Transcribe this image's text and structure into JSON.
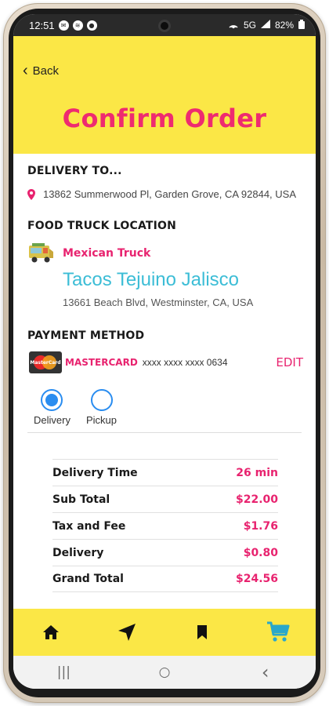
{
  "status": {
    "time": "12:51",
    "network": "5G",
    "battery": "82%"
  },
  "header": {
    "back_label": "Back",
    "title": "Confirm Order",
    "background": "#fbe746",
    "title_color": "#ee2b70"
  },
  "delivery": {
    "heading": "DELIVERY TO...",
    "address": "13862 Summerwood Pl, Garden Grove, CA 92844, USA"
  },
  "truck": {
    "heading": "FOOD TRUCK LOCATION",
    "type": "Mexican Truck",
    "name": "Tacos Tejuino Jalisco",
    "address": "13661 Beach Blvd, Westminster, CA, USA"
  },
  "payment": {
    "heading": "PAYMENT METHOD",
    "brand": "MASTERCARD",
    "card_number": "xxxx xxxx xxxx  0634",
    "edit_label": "EDIT"
  },
  "fulfillment": {
    "options": [
      {
        "label": "Delivery",
        "selected": true
      },
      {
        "label": "Pickup",
        "selected": false
      }
    ]
  },
  "summary": {
    "rows": [
      {
        "label": "Delivery Time",
        "value": "26 min"
      },
      {
        "label": "Sub Total",
        "value": "$22.00"
      },
      {
        "label": "Tax and Fee",
        "value": "$1.76"
      },
      {
        "label": "Delivery",
        "value": "$0.80"
      },
      {
        "label": "Grand Total",
        "value": "$24.56"
      }
    ]
  },
  "bottom_nav": {
    "items": [
      {
        "icon": "home-icon",
        "active": false
      },
      {
        "icon": "navigation-arrow-icon",
        "active": false
      },
      {
        "icon": "bookmark-icon",
        "active": false
      },
      {
        "icon": "cart-icon",
        "active": true
      }
    ],
    "active_color": "#2aa7c9"
  },
  "system_nav": {
    "recents": "|||",
    "home": "○",
    "back": "‹"
  }
}
